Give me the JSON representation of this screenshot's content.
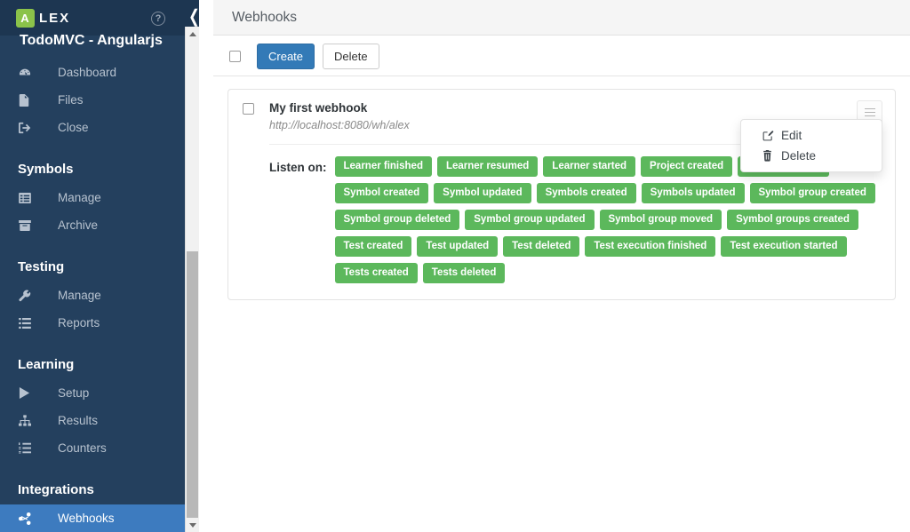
{
  "brand": {
    "logo_mark": "A",
    "logo_rest": "LEX",
    "help_icon": "?",
    "collapse_icon": "chevron-left"
  },
  "sidebar": {
    "project_title": "TodoMVC - Angularjs",
    "sections": [
      {
        "title": null,
        "items": [
          {
            "label": "Dashboard",
            "icon": "dashboard-icon",
            "active": false
          },
          {
            "label": "Files",
            "icon": "file-icon",
            "active": false
          },
          {
            "label": "Close",
            "icon": "sign-out-icon",
            "active": false
          }
        ]
      },
      {
        "title": "Symbols",
        "items": [
          {
            "label": "Manage",
            "icon": "list-alt-icon",
            "active": false
          },
          {
            "label": "Archive",
            "icon": "archive-icon",
            "active": false
          }
        ]
      },
      {
        "title": "Testing",
        "items": [
          {
            "label": "Manage",
            "icon": "wrench-icon",
            "active": false
          },
          {
            "label": "Reports",
            "icon": "list-icon",
            "active": false
          }
        ]
      },
      {
        "title": "Learning",
        "items": [
          {
            "label": "Setup",
            "icon": "play-icon",
            "active": false
          },
          {
            "label": "Results",
            "icon": "sitemap-icon",
            "active": false
          },
          {
            "label": "Counters",
            "icon": "ordered-list-icon",
            "active": false
          }
        ]
      },
      {
        "title": "Integrations",
        "items": [
          {
            "label": "Webhooks",
            "icon": "share-icon",
            "active": true
          }
        ]
      }
    ]
  },
  "header": {
    "title": "Webhooks"
  },
  "toolbar": {
    "select_all_checked": false,
    "create_label": "Create",
    "delete_label": "Delete"
  },
  "webhook": {
    "checked": false,
    "name": "My first webhook",
    "url": "http://localhost:8080/wh/alex",
    "listen_label": "Listen on:",
    "menu_icon": "hamburger-icon",
    "events": [
      "Learner finished",
      "Learner resumed",
      "Learner started",
      "Project created",
      "Project deleted",
      "Symbol created",
      "Symbol updated",
      "Symbols created",
      "Symbols updated",
      "Symbol group created",
      "Symbol group deleted",
      "Symbol group updated",
      "Symbol group moved",
      "Symbol groups created",
      "Test created",
      "Test updated",
      "Test deleted",
      "Test execution finished",
      "Test execution started",
      "Tests created",
      "Tests deleted"
    ]
  },
  "dropdown": {
    "visible": true,
    "items": [
      {
        "label": "Edit",
        "icon": "edit-pencil-icon"
      },
      {
        "label": "Delete",
        "icon": "trash-icon"
      }
    ]
  },
  "colors": {
    "sidebar_bg": "#24405e",
    "sidebar_brandbar_bg": "#1d3651",
    "sidebar_active": "#3d7bbf",
    "accent_blue": "#337ab7",
    "badge_green": "#5cb85c",
    "logo_green": "#8bc34a",
    "header_bg": "#f5f5f5"
  }
}
